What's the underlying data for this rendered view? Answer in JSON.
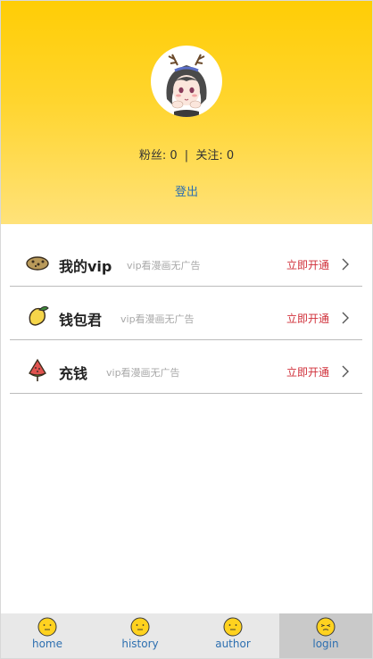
{
  "profile": {
    "stats_followers": "粉丝: 0",
    "stats_sep": "|",
    "stats_following": "关注: 0",
    "logout": "登出",
    "avatar_icon": "anime-avatar-icon"
  },
  "menu": {
    "items": [
      {
        "title": "我的vip",
        "desc": "vip看漫画无广告",
        "action": "立即开通",
        "icon": "cookie-icon"
      },
      {
        "title": "钱包君",
        "desc": "vip看漫画无广告",
        "action": "立即开通",
        "icon": "lemon-icon"
      },
      {
        "title": "充钱",
        "desc": "vip看漫画无广告",
        "action": "立即开通",
        "icon": "watermelon-icon"
      }
    ]
  },
  "tabs": [
    {
      "label": "home",
      "icon": "smiley-face-icon"
    },
    {
      "label": "history",
      "icon": "smiley-face-icon"
    },
    {
      "label": "author",
      "icon": "smiley-face-icon"
    },
    {
      "label": "login",
      "icon": "wink-face-icon"
    }
  ],
  "colors": {
    "header_top": "#ffcd05",
    "header_bottom": "#ffe27a",
    "link_blue": "#2d6fb0",
    "action_red": "#d0303a",
    "tab_active": "#c9c9c9"
  }
}
